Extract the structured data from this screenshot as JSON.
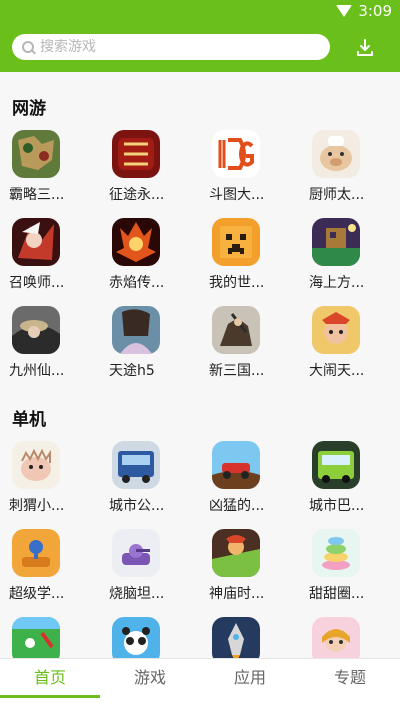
{
  "colors": {
    "brand": "#6bbf1a",
    "header_text": "#ffffff"
  },
  "status_bar": {
    "time": "3:09",
    "icons": [
      "wifi-icon",
      "battery-icon"
    ]
  },
  "search": {
    "placeholder": "搜索游戏",
    "value": ""
  },
  "header": {
    "download_icon": "download-icon"
  },
  "sections": [
    {
      "title": "网游",
      "items": [
        {
          "label": "霸略三...",
          "icon": "three-kingdoms-map-icon"
        },
        {
          "label": "征途永...",
          "icon": "zhengtu-icon"
        },
        {
          "label": "斗图大...",
          "icon": "dg-logo-icon"
        },
        {
          "label": "厨师太...",
          "icon": "chef-pig-icon"
        },
        {
          "label": "召唤师...",
          "icon": "summoner-icon"
        },
        {
          "label": "赤焰传...",
          "icon": "red-flame-icon"
        },
        {
          "label": "我的世...",
          "icon": "minecraft-face-icon"
        },
        {
          "label": "海上方...",
          "icon": "sea-square-icon"
        },
        {
          "label": "九州仙...",
          "icon": "jiuzhou-icon"
        },
        {
          "label": "天途h5",
          "icon": "tiantu-icon"
        },
        {
          "label": "新三国...",
          "icon": "new-three-kingdoms-icon"
        },
        {
          "label": "大闹天...",
          "icon": "monkey-king-icon"
        }
      ]
    },
    {
      "title": "单机",
      "items": [
        {
          "label": "刺猬小...",
          "icon": "hedgehog-icon"
        },
        {
          "label": "城市公...",
          "icon": "city-bus-icon"
        },
        {
          "label": "凶猛的...",
          "icon": "fierce-car-icon"
        },
        {
          "label": "城市巴...",
          "icon": "city-bus-2-icon"
        },
        {
          "label": "超级学...",
          "icon": "super-student-icon"
        },
        {
          "label": "烧脑坦...",
          "icon": "brain-tank-icon"
        },
        {
          "label": "神庙时...",
          "icon": "temple-run-icon"
        },
        {
          "label": "甜甜圈...",
          "icon": "donut-stack-icon"
        },
        {
          "label": "",
          "icon": "soccer-field-icon"
        },
        {
          "label": "",
          "icon": "panda-icon"
        },
        {
          "label": "",
          "icon": "rocket-icon"
        },
        {
          "label": "",
          "icon": "girl-icon"
        }
      ]
    }
  ],
  "tabs": [
    {
      "label": "首页",
      "active": true
    },
    {
      "label": "游戏",
      "active": false
    },
    {
      "label": "应用",
      "active": false
    },
    {
      "label": "专题",
      "active": false
    }
  ]
}
